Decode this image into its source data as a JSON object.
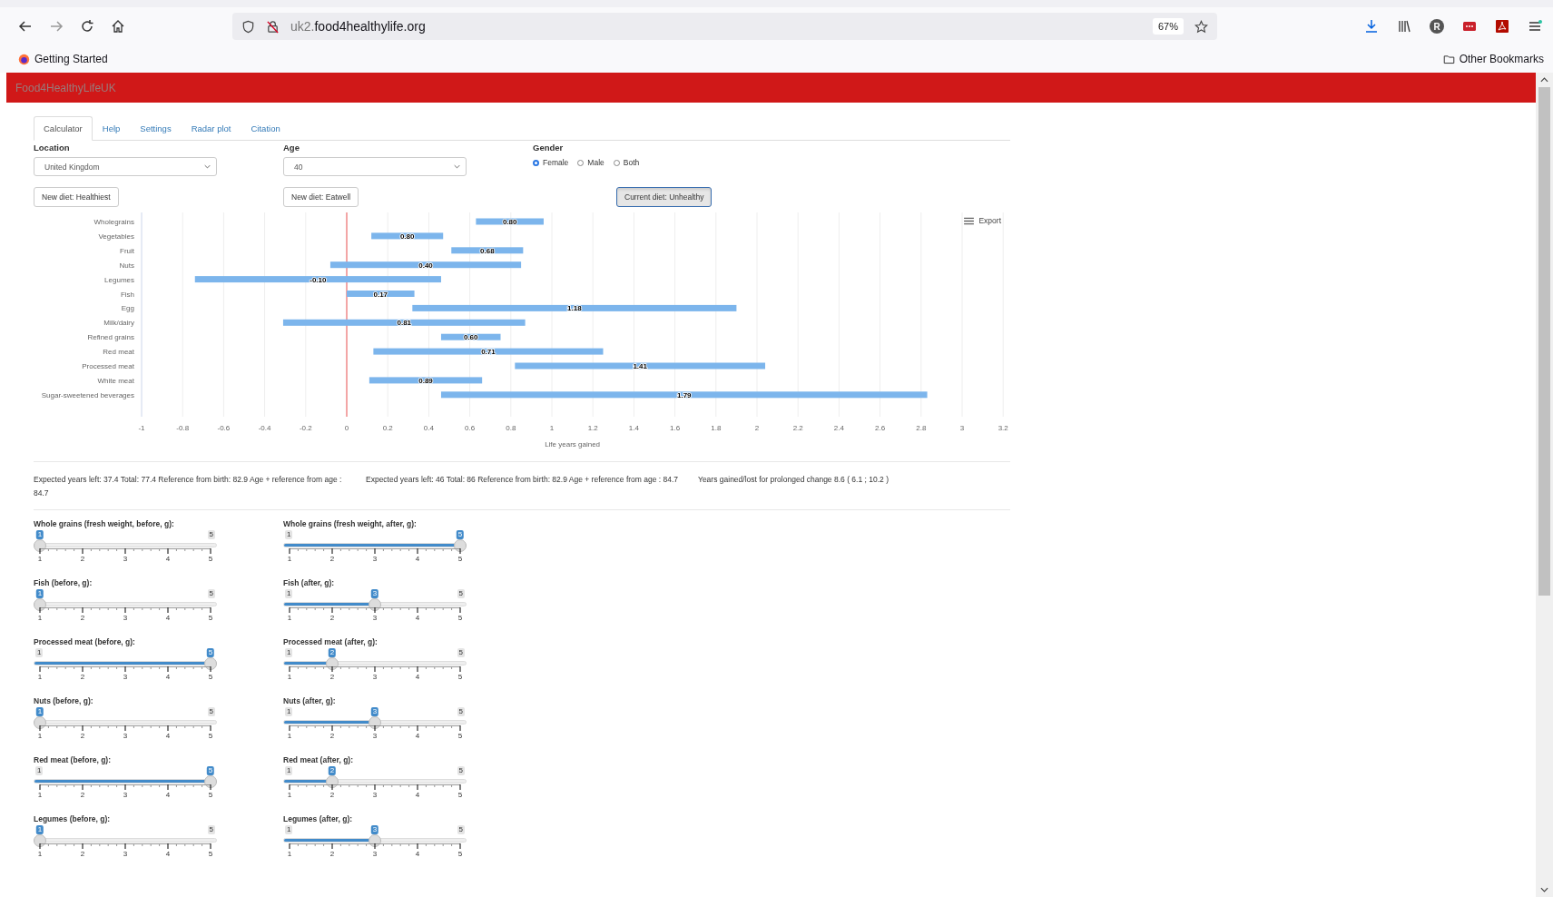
{
  "browser": {
    "url_host_prefix": "uk2.",
    "url_domain": "food4healthylife.org",
    "zoom": "67%",
    "bookmarks": [
      {
        "label": "Getting Started",
        "kind": "site"
      }
    ],
    "other_bookmarks": "Other Bookmarks",
    "profile_initial": "R"
  },
  "header": {
    "title": "Food4HealthyLifeUK"
  },
  "tabs": [
    {
      "label": "Calculator",
      "selected": true
    },
    {
      "label": "Help",
      "selected": false
    },
    {
      "label": "Settings",
      "selected": false
    },
    {
      "label": "Radar plot",
      "selected": false
    },
    {
      "label": "Citation",
      "selected": false
    }
  ],
  "location": {
    "label": "Location",
    "value": "United Kingdom"
  },
  "age": {
    "label": "Age",
    "value": "40"
  },
  "gender": {
    "label": "Gender",
    "options": [
      {
        "label": "Female",
        "selected": true
      },
      {
        "label": "Male",
        "selected": false
      },
      {
        "label": "Both",
        "selected": false
      }
    ]
  },
  "diet_buttons": [
    {
      "label": "New diet: Healthiest",
      "selected": false
    },
    {
      "label": "New diet: Eatwell",
      "selected": false
    },
    {
      "label": "Current diet: Unhealthy",
      "selected": true
    }
  ],
  "chart": {
    "export_label": "Export",
    "chart_data": {
      "type": "bar",
      "orientation": "horizontal",
      "xlabel": "Life years gained",
      "categories": [
        "Wholegrains",
        "Vegetables",
        "Fruit",
        "Nuts",
        "Legumes",
        "Fish",
        "Egg",
        "Milk/dairy",
        "Refined grains",
        "Red meat",
        "Processed meat",
        "White meat",
        "Sugar-sweetened beverages"
      ],
      "color": "#7cb5ec",
      "values": [
        0.33,
        0.35,
        0.35,
        0.93,
        1.2,
        0.33,
        1.58,
        1.18,
        0.29,
        1.12,
        1.22,
        0.55,
        2.37
      ],
      "base": [
        0.63,
        0.12,
        0.51,
        -0.08,
        -0.74,
        0.0,
        0.32,
        -0.31,
        0.46,
        0.13,
        0.82,
        0.11,
        0.46
      ],
      "grid": true,
      "ref_lines": [
        {
          "axis": "x",
          "value": 0,
          "color": "#ee5555"
        }
      ],
      "annotations": [
        "0.80",
        "0.80",
        "0.68",
        "0.40",
        "-0.10",
        "0.17",
        "1.18",
        "0.81",
        "0.60",
        "0.71",
        "1.41",
        "0.89",
        "1.79"
      ],
      "xlim": [
        -1,
        3.2
      ],
      "xticks": [
        -1,
        -0.8,
        -0.6,
        -0.4,
        -0.2,
        0,
        0.2,
        0.4,
        0.6,
        0.8,
        1,
        1.2,
        1.4,
        1.6,
        1.8,
        2,
        2.2,
        2.4,
        2.6,
        2.8,
        3,
        3.2
      ]
    }
  },
  "results": [
    "Expected years left: 37.4 Total: 77.4 Reference from birth: 82.9 Age + reference from age : 84.7",
    "Expected years left: 46 Total: 86 Reference from birth: 82.9 Age + reference from age : 84.7",
    "Years gained/lost for prolonged change 8.6 ( 6.1 ; 10.2 )"
  ],
  "sliders": [
    {
      "label": "Whole grains (fresh weight, before, g):",
      "value": "1",
      "max_label": "5",
      "level": 0,
      "ticks": [
        "1",
        "2",
        "3",
        "4",
        "5"
      ]
    },
    {
      "label": "Whole grains (fresh weight, after, g):",
      "value": "5",
      "min_label": "1",
      "level": 1,
      "ticks": [
        "1",
        "2",
        "3",
        "4",
        "5"
      ]
    },
    {
      "label": "Fish (before, g):",
      "value": "1",
      "max_label": "5",
      "level": 0,
      "ticks": [
        "1",
        "2",
        "3",
        "4",
        "5"
      ]
    },
    {
      "label": "Fish (after, g):",
      "value": "3",
      "min_label": "1",
      "max_label": "5",
      "level": 0.5,
      "ticks": [
        "1",
        "2",
        "3",
        "4",
        "5"
      ]
    },
    {
      "label": "Processed meat (before, g):",
      "value": "5",
      "min_label": "1",
      "level": 1,
      "ticks": [
        "1",
        "2",
        "3",
        "4",
        "5"
      ]
    },
    {
      "label": "Processed meat (after, g):",
      "value": "2",
      "min_label": "1",
      "max_label": "5",
      "level": 0.25,
      "ticks": [
        "1",
        "2",
        "3",
        "4",
        "5"
      ]
    },
    {
      "label": "Nuts (before, g):",
      "value": "1",
      "max_label": "5",
      "level": 0,
      "ticks": [
        "1",
        "2",
        "3",
        "4",
        "5"
      ]
    },
    {
      "label": "Nuts (after, g):",
      "value": "3",
      "min_label": "1",
      "max_label": "5",
      "level": 0.5,
      "ticks": [
        "1",
        "2",
        "3",
        "4",
        "5"
      ]
    },
    {
      "label": "Red meat (before, g):",
      "value": "5",
      "min_label": "1",
      "level": 1,
      "ticks": [
        "1",
        "2",
        "3",
        "4",
        "5"
      ]
    },
    {
      "label": "Red meat (after, g):",
      "value": "2",
      "min_label": "1",
      "max_label": "5",
      "level": 0.25,
      "ticks": [
        "1",
        "2",
        "3",
        "4",
        "5"
      ]
    },
    {
      "label": "Legumes (before, g):",
      "value": "1",
      "max_label": "5",
      "level": 0,
      "ticks": [
        "1",
        "2",
        "3",
        "4",
        "5"
      ]
    },
    {
      "label": "Legumes (after, g):",
      "value": "3",
      "min_label": "1",
      "max_label": "5",
      "level": 0.5,
      "ticks": [
        "1",
        "2",
        "3",
        "4",
        "5"
      ]
    }
  ]
}
